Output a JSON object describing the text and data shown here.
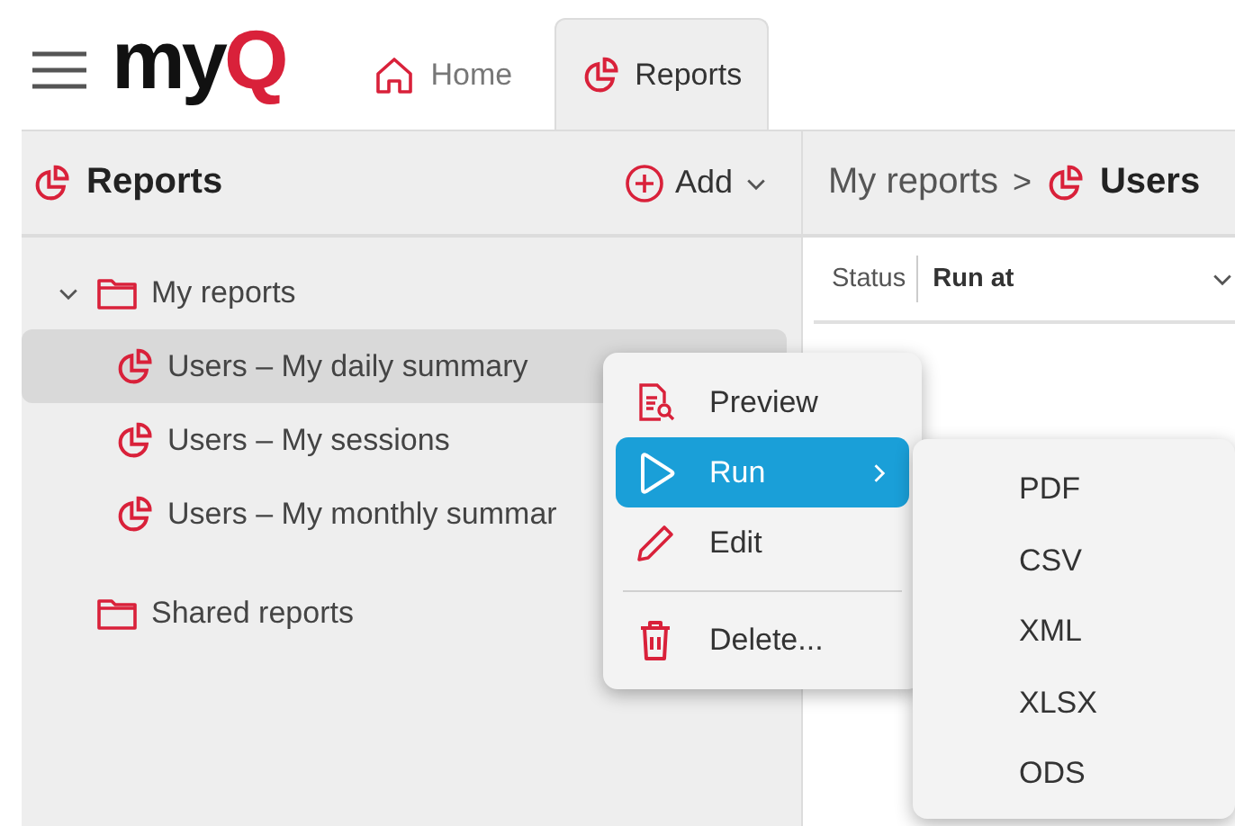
{
  "logo": {
    "main": "my",
    "accent": "Q"
  },
  "tabs": [
    {
      "label": "Home",
      "selected": false
    },
    {
      "label": "Reports",
      "selected": true
    }
  ],
  "panel": {
    "title": "Reports",
    "add_button": "Add"
  },
  "tree": [
    {
      "label": "My reports",
      "kind": "folder",
      "expanded": true,
      "children": [
        {
          "label": "Users – My daily summary",
          "kind": "report",
          "selected": true
        },
        {
          "label": "Users – My sessions",
          "kind": "report",
          "selected": false
        },
        {
          "label": "Users – My monthly summar",
          "kind": "report",
          "selected": false
        }
      ]
    },
    {
      "label": "Shared reports",
      "kind": "folder"
    }
  ],
  "breadcrumb": {
    "parent": "My reports",
    "separator": ">",
    "current": "Users"
  },
  "table_columns": [
    "Status",
    "Run at"
  ],
  "context_menu": [
    {
      "label": "Preview",
      "selected": false
    },
    {
      "label": "Run",
      "selected": true,
      "submenu": true
    },
    {
      "label": "Edit",
      "selected": false
    },
    {
      "label": "Delete...",
      "selected": false,
      "separator_before": true
    }
  ],
  "submenu": [
    "PDF",
    "CSV",
    "XML",
    "XLSX",
    "ODS"
  ]
}
